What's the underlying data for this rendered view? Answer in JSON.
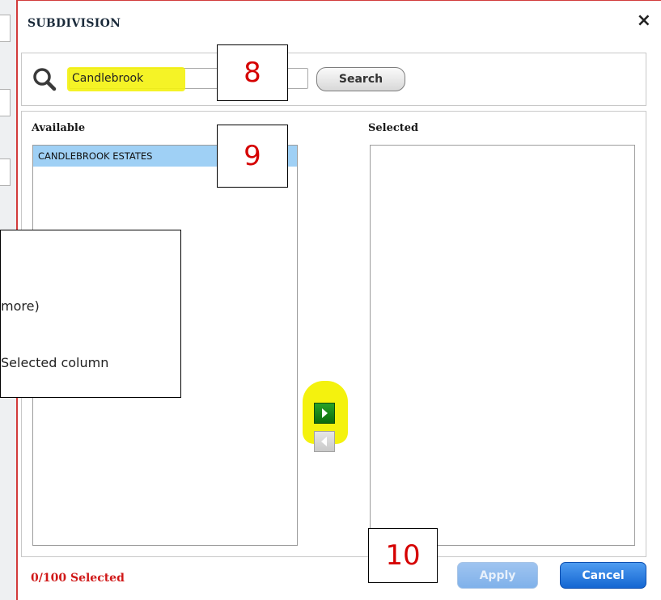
{
  "dialog": {
    "title": "SUBDIVISION",
    "close_symbol": "×"
  },
  "search": {
    "icon": "magnifier-icon",
    "value": "Candlebrook",
    "button_label": "Search"
  },
  "available": {
    "label": "Available",
    "items": [
      "CANDLEBROOK ESTATES"
    ]
  },
  "selected": {
    "label": "Selected",
    "items": []
  },
  "move_controls": {
    "add_icon": "right-arrow-icon",
    "remove_icon": "left-arrow-icon"
  },
  "footer": {
    "count_text": "0/100 Selected",
    "apply_label": "Apply",
    "cancel_label": "Cancel"
  },
  "annotations": {
    "callout_8": "8",
    "callout_9": "9",
    "callout_10": "10",
    "note_lines": [
      "more)",
      "Selected column"
    ]
  },
  "colors": {
    "highlight": "#f4f20e",
    "selected_row": "#9fd0f5",
    "count_red": "#d01818",
    "cancel_blue": "#1466d2",
    "apply_disabled": "#8fbaed"
  }
}
